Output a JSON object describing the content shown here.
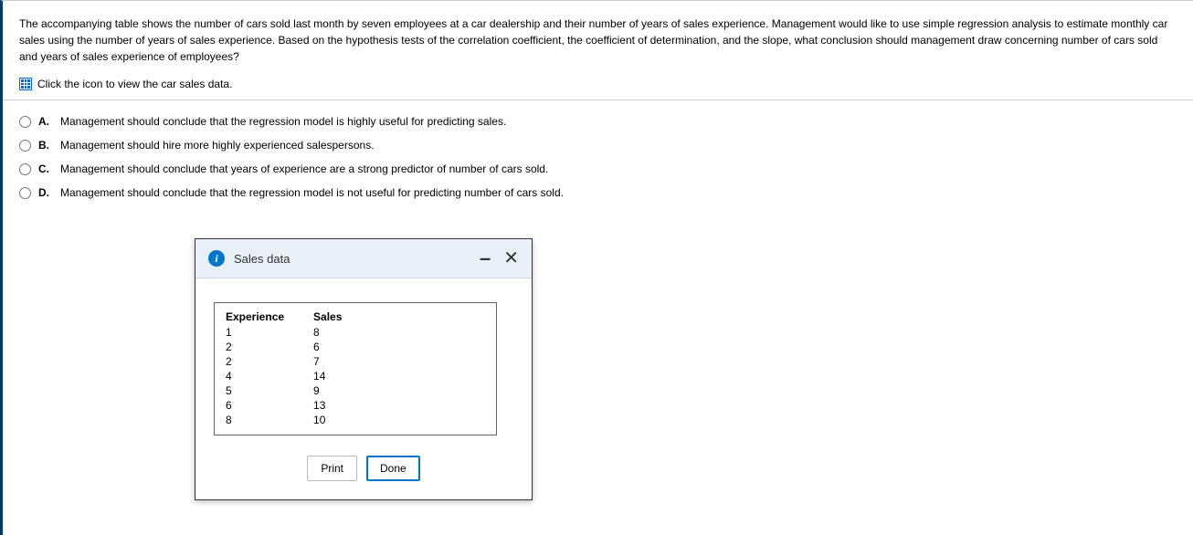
{
  "question": {
    "prompt": "The accompanying table shows the number of cars sold last month by seven employees at a car dealership and their number of years of sales experience. Management would like to use simple regression analysis to estimate monthly car sales using the number of years of sales experience. Based on the hypothesis tests of the correlation coefficient, the coefficient of determination, and the slope, what conclusion should management draw concerning number of cars sold and years of sales experience of employees?",
    "data_link_text": "Click the icon to view the car sales data."
  },
  "choices": [
    {
      "letter": "A.",
      "text": "Management should conclude that the regression model is highly useful for predicting sales."
    },
    {
      "letter": "B.",
      "text": "Management should hire more highly experienced salespersons."
    },
    {
      "letter": "C.",
      "text": "Management should conclude that years of experience are a strong predictor of number of cars sold."
    },
    {
      "letter": "D.",
      "text": "Management should conclude that the regression model is not useful for predicting number of cars sold."
    }
  ],
  "modal": {
    "title": "Sales data",
    "table": {
      "headers": [
        "Experience",
        "Sales"
      ],
      "rows": [
        [
          "1",
          "8"
        ],
        [
          "2",
          "6"
        ],
        [
          "2",
          "7"
        ],
        [
          "4",
          "14"
        ],
        [
          "5",
          "9"
        ],
        [
          "6",
          "13"
        ],
        [
          "8",
          "10"
        ]
      ]
    },
    "buttons": {
      "print": "Print",
      "done": "Done"
    }
  }
}
